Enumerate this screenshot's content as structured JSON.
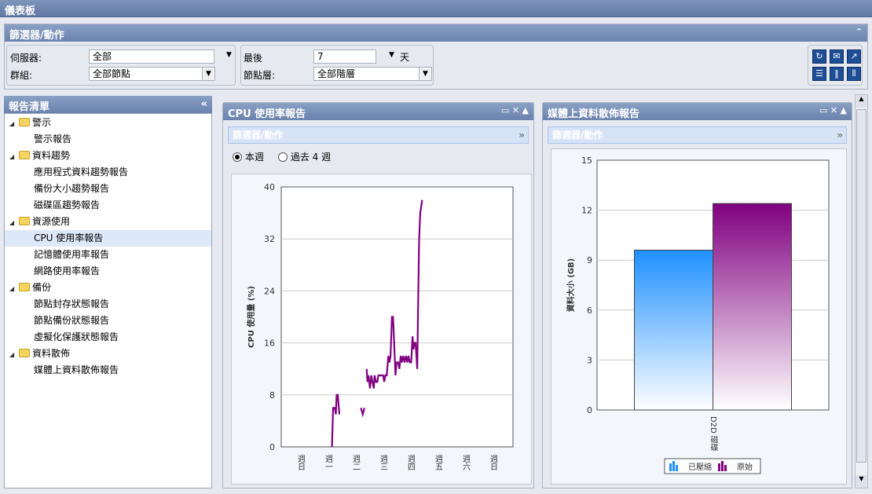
{
  "app": {
    "title": "儀表板"
  },
  "filters": {
    "title": "篩選器/動作",
    "server_label": "伺服器:",
    "server_value": "全部",
    "group_label": "群組:",
    "group_value": "全部節點",
    "last_label": "最後",
    "last_value": "7",
    "days_label": "天",
    "tier_label": "節點層:",
    "tier_value": "全部階層"
  },
  "toolbar": {
    "icons": [
      "refresh-icon",
      "email-icon",
      "export-icon",
      "layout-1-column-icon",
      "layout-2-column-icon",
      "layout-3-column-icon"
    ]
  },
  "sidebar": {
    "title": "報告清單",
    "groups": [
      {
        "label": "警示",
        "items": [
          "警示報告"
        ]
      },
      {
        "label": "資料趨勢",
        "items": [
          "應用程式資料趨勢報告",
          "備份大小趨勢報告",
          "磁碟區趨勢報告"
        ]
      },
      {
        "label": "資源使用",
        "items": [
          "CPU 使用率報告",
          "記憶體使用率報告",
          "網路使用率報告"
        ]
      },
      {
        "label": "備份",
        "items": [
          "節點封存狀態報告",
          "節點備份狀態報告",
          "虛擬化保護狀態報告"
        ]
      },
      {
        "label": "資料散佈",
        "items": [
          "媒體上資料散佈報告"
        ]
      }
    ],
    "selected": "CPU 使用率報告"
  },
  "cpu_panel": {
    "title": "CPU 使用率報告",
    "filter_title": "篩選器/動作",
    "radio_this_week": "本週",
    "radio_last_4": "過去 4 週",
    "selected_radio": "this_week"
  },
  "media_panel": {
    "title": "媒體上資料散佈報告",
    "filter_title": "篩選器/動作"
  },
  "colors": {
    "accent": "#6a82ad",
    "line": "#800080",
    "compressed": "#1e90ff",
    "raw": "#800080"
  },
  "chart_data": [
    {
      "type": "line",
      "ylabel": "CPU 使用量 (%)",
      "ylim": [
        0,
        40
      ],
      "yticks": [
        0,
        8,
        16,
        24,
        32,
        40
      ],
      "categories": [
        "週日",
        "週一",
        "週二",
        "週三",
        "週四",
        "週五",
        "週六",
        "週日"
      ],
      "series": [
        {
          "name": "CPU",
          "segments": [
            [
              [
                1.16,
                0
              ],
              [
                1.2,
                6
              ],
              [
                1.26,
                6
              ],
              [
                1.3,
                5
              ],
              [
                1.33,
                8
              ],
              [
                1.37,
                8
              ],
              [
                1.43,
                5
              ]
            ],
            [
              [
                2.21,
                6
              ],
              [
                2.28,
                5
              ],
              [
                2.34,
                6
              ]
            ],
            [
              [
                2.42,
                12
              ],
              [
                2.45,
                10
              ],
              [
                2.49,
                11
              ],
              [
                2.54,
                9
              ],
              [
                2.59,
                11
              ],
              [
                2.63,
                10
              ],
              [
                2.68,
                9
              ],
              [
                2.71,
                11
              ],
              [
                2.76,
                10
              ],
              [
                2.81,
                10
              ],
              [
                2.85,
                11
              ],
              [
                3.02,
                11
              ],
              [
                3.06,
                10
              ],
              [
                3.1,
                11
              ],
              [
                3.15,
                11
              ],
              [
                3.21,
                14
              ],
              [
                3.25,
                13
              ],
              [
                3.29,
                14
              ],
              [
                3.34,
                20
              ],
              [
                3.38,
                20
              ],
              [
                3.42,
                16
              ],
              [
                3.47,
                11
              ],
              [
                3.51,
                13
              ],
              [
                3.57,
                13
              ],
              [
                3.61,
                12
              ],
              [
                3.66,
                14
              ],
              [
                3.7,
                13
              ],
              [
                3.75,
                14
              ],
              [
                3.8,
                13
              ],
              [
                3.85,
                14
              ],
              [
                3.9,
                13
              ],
              [
                3.94,
                14
              ],
              [
                3.99,
                13
              ],
              [
                4.04,
                13
              ],
              [
                4.09,
                17
              ],
              [
                4.12,
                15
              ],
              [
                4.16,
                16
              ],
              [
                4.2,
                16
              ],
              [
                4.26,
                12
              ],
              [
                4.3,
                24
              ],
              [
                4.33,
                32
              ],
              [
                4.37,
                36
              ],
              [
                4.44,
                38
              ]
            ]
          ]
        }
      ]
    },
    {
      "type": "bar",
      "ylabel": "資料大小 (GB)",
      "ylim": [
        0,
        15
      ],
      "yticks": [
        0,
        3,
        6,
        9,
        12,
        15
      ],
      "categories": [
        "D2D 磁碟"
      ],
      "series": [
        {
          "name": "已壓縮",
          "values": [
            9.6
          ]
        },
        {
          "name": "原始",
          "values": [
            12.4
          ]
        }
      ],
      "legend": "bottom"
    }
  ]
}
